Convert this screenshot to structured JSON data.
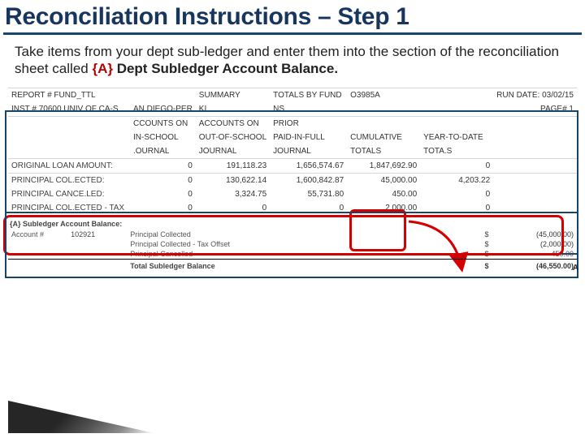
{
  "title": "Reconciliation Instructions – Step 1",
  "instruction_pre": "Take items from your dept sub-ledger and enter them into the section of the reconciliation sheet called ",
  "instruction_A": "{A}",
  "instruction_bold": " Dept Subledger Account Balance.",
  "report": {
    "r1": {
      "c1": "REPORT # FUND_TTL",
      "c2": "",
      "c3": "SUMMARY",
      "c4": "TOTALS BY FUND",
      "c5": "O3985A",
      "c6": "",
      "c7": "RUN DATE: 03/02/15"
    },
    "r2": {
      "c1": "INST # 70600   UNIV OF CA-S",
      "c2": "AN DIEGO-PER",
      "c3": "KI",
      "c4": "NS",
      "c5": "",
      "c6": "",
      "c7": "PAGE#  1"
    },
    "r3": {
      "c1": "",
      "c2": "CCOUNTS ON",
      "c3": "ACCOUNTS ON",
      "c4": "PRIOR",
      "c5": "",
      "c6": "",
      "c7": ""
    },
    "r4": {
      "c1": "",
      "c2": "IN-SCHOOL",
      "c3": "OUT-OF-SCHOOL",
      "c4": "PAID-IN-FULL",
      "c5": "CUMULATIVE",
      "c6": "YEAR-TO-DATE",
      "c7": ""
    },
    "r5": {
      "c1": "",
      "c2": ".OURNAL",
      "c3": "JOURNAL",
      "c4": "JOURNAL",
      "c5": "TOTALS",
      "c6": "TOTA.S",
      "c7": ""
    },
    "r6": {
      "c1": "ORIGINAL LOAN AMOUNT:",
      "c2": "0",
      "c3": "191,118.23",
      "c4": "1,656,574.67",
      "c5": "1,847,692.90",
      "c6": "0",
      "c7": ""
    },
    "r7": {
      "c1": "PRINCIPAL COL.ECTED:",
      "c2": "0",
      "c3": "130,622.14",
      "c4": "1,600,842.87",
      "c5": "45,000.00",
      "c6": "4,203.22",
      "c7": ""
    },
    "r8": {
      "c1": "PRINCIPAL CANCE.LED:",
      "c2": "0",
      "c3": "3,324.75",
      "c4": "55,731.80",
      "c5": "450.00",
      "c6": "0",
      "c7": ""
    },
    "r9": {
      "c1": "PRINCIPAL COL.ECTED - TAX",
      "c2": "0",
      "c3": "0",
      "c4": "0",
      "c5": "2,000.00",
      "c6": "0",
      "c7": ""
    }
  },
  "subledger": {
    "heading": "{A}  Subledger Account Balance:",
    "acct_label": "Account #",
    "acct_value": "102921",
    "rows": {
      "a": {
        "label": "Principal Collected",
        "sym": "$",
        "val": "(45,000.00)"
      },
      "b": {
        "label": "Principal Collected - Tax Offset",
        "sym": "$",
        "val": "(2,000.00)"
      },
      "c": {
        "label": "Principal Cancelled",
        "sym": "$",
        "val": "450.00"
      }
    },
    "total_label": "Total Subledger Balance",
    "total_sym": "$",
    "total_val": "(46,550.00)",
    "right_tag": "A"
  }
}
